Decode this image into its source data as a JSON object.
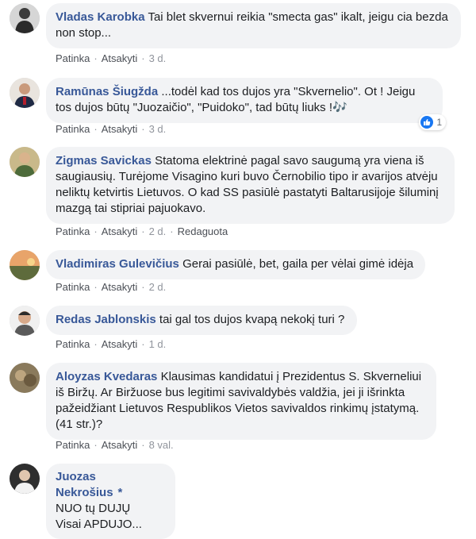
{
  "action_labels": {
    "like": "Patinka",
    "reply": "Atsakyti",
    "edited": "Redaguota",
    "separator": "·"
  },
  "comments": [
    {
      "author": "Vladas Karobka",
      "text": "Tai blet skvernui reikia \"smecta gas\" ikalt, jeigu cia bezda non stop...",
      "time": "3 d."
    },
    {
      "author": "Ramūnas Šiugžda",
      "text": "...todėl kad tos dujos yra \"Skvernelio\". Ot ! Jeigu tos dujos būtų \"Juozaičio\", \"Puidoko\", tad būtų liuks !🎶",
      "time": "3 d.",
      "reaction_count": "1"
    },
    {
      "author": "Zigmas Savickas",
      "text": "Statoma elektrinė pagal savo saugumą yra viena iš saugiausių. Turėjome Visagino kuri buvo Černobilio tipo ir avarijos atvėju neliktų ketvirtis Lietuvos. O kad SS pasiūlė pastatyti Baltarusijoje šiluminį mazgą tai stipriai pajuokavo.",
      "time": "2 d.",
      "edited": true
    },
    {
      "author": "Vladimiras Gulevičius",
      "text": "Gerai pasiūlė, bet, gaila per vėlai gimė idėja",
      "time": "2 d."
    },
    {
      "author": "Redas Jablonskis",
      "text": "tai gal tos dujos kvapą nekokį turi ?",
      "time": "1 d."
    },
    {
      "author": "Aloyzas Kvedaras",
      "text": "Klausimas kandidatui į Prezidentus S. Skverneliui iš Biržų. Ar Biržuose bus legitimi savivaldybės valdžia, jei ji išrinkta pažeidžiant Lietuvos Respublikos Vietos savivaldos rinkimų įstatymą. (41 str.)?",
      "time": "8 val."
    },
    {
      "author": "Juozas Nekrošius",
      "author_badge": "*",
      "text_lines": [
        "NUO tų DUJŲ",
        "Visai APDUJO..."
      ]
    }
  ],
  "colors": {
    "author": "#385898",
    "bubble": "#f2f3f5",
    "meta": "#606770",
    "like": "#1877f2"
  }
}
